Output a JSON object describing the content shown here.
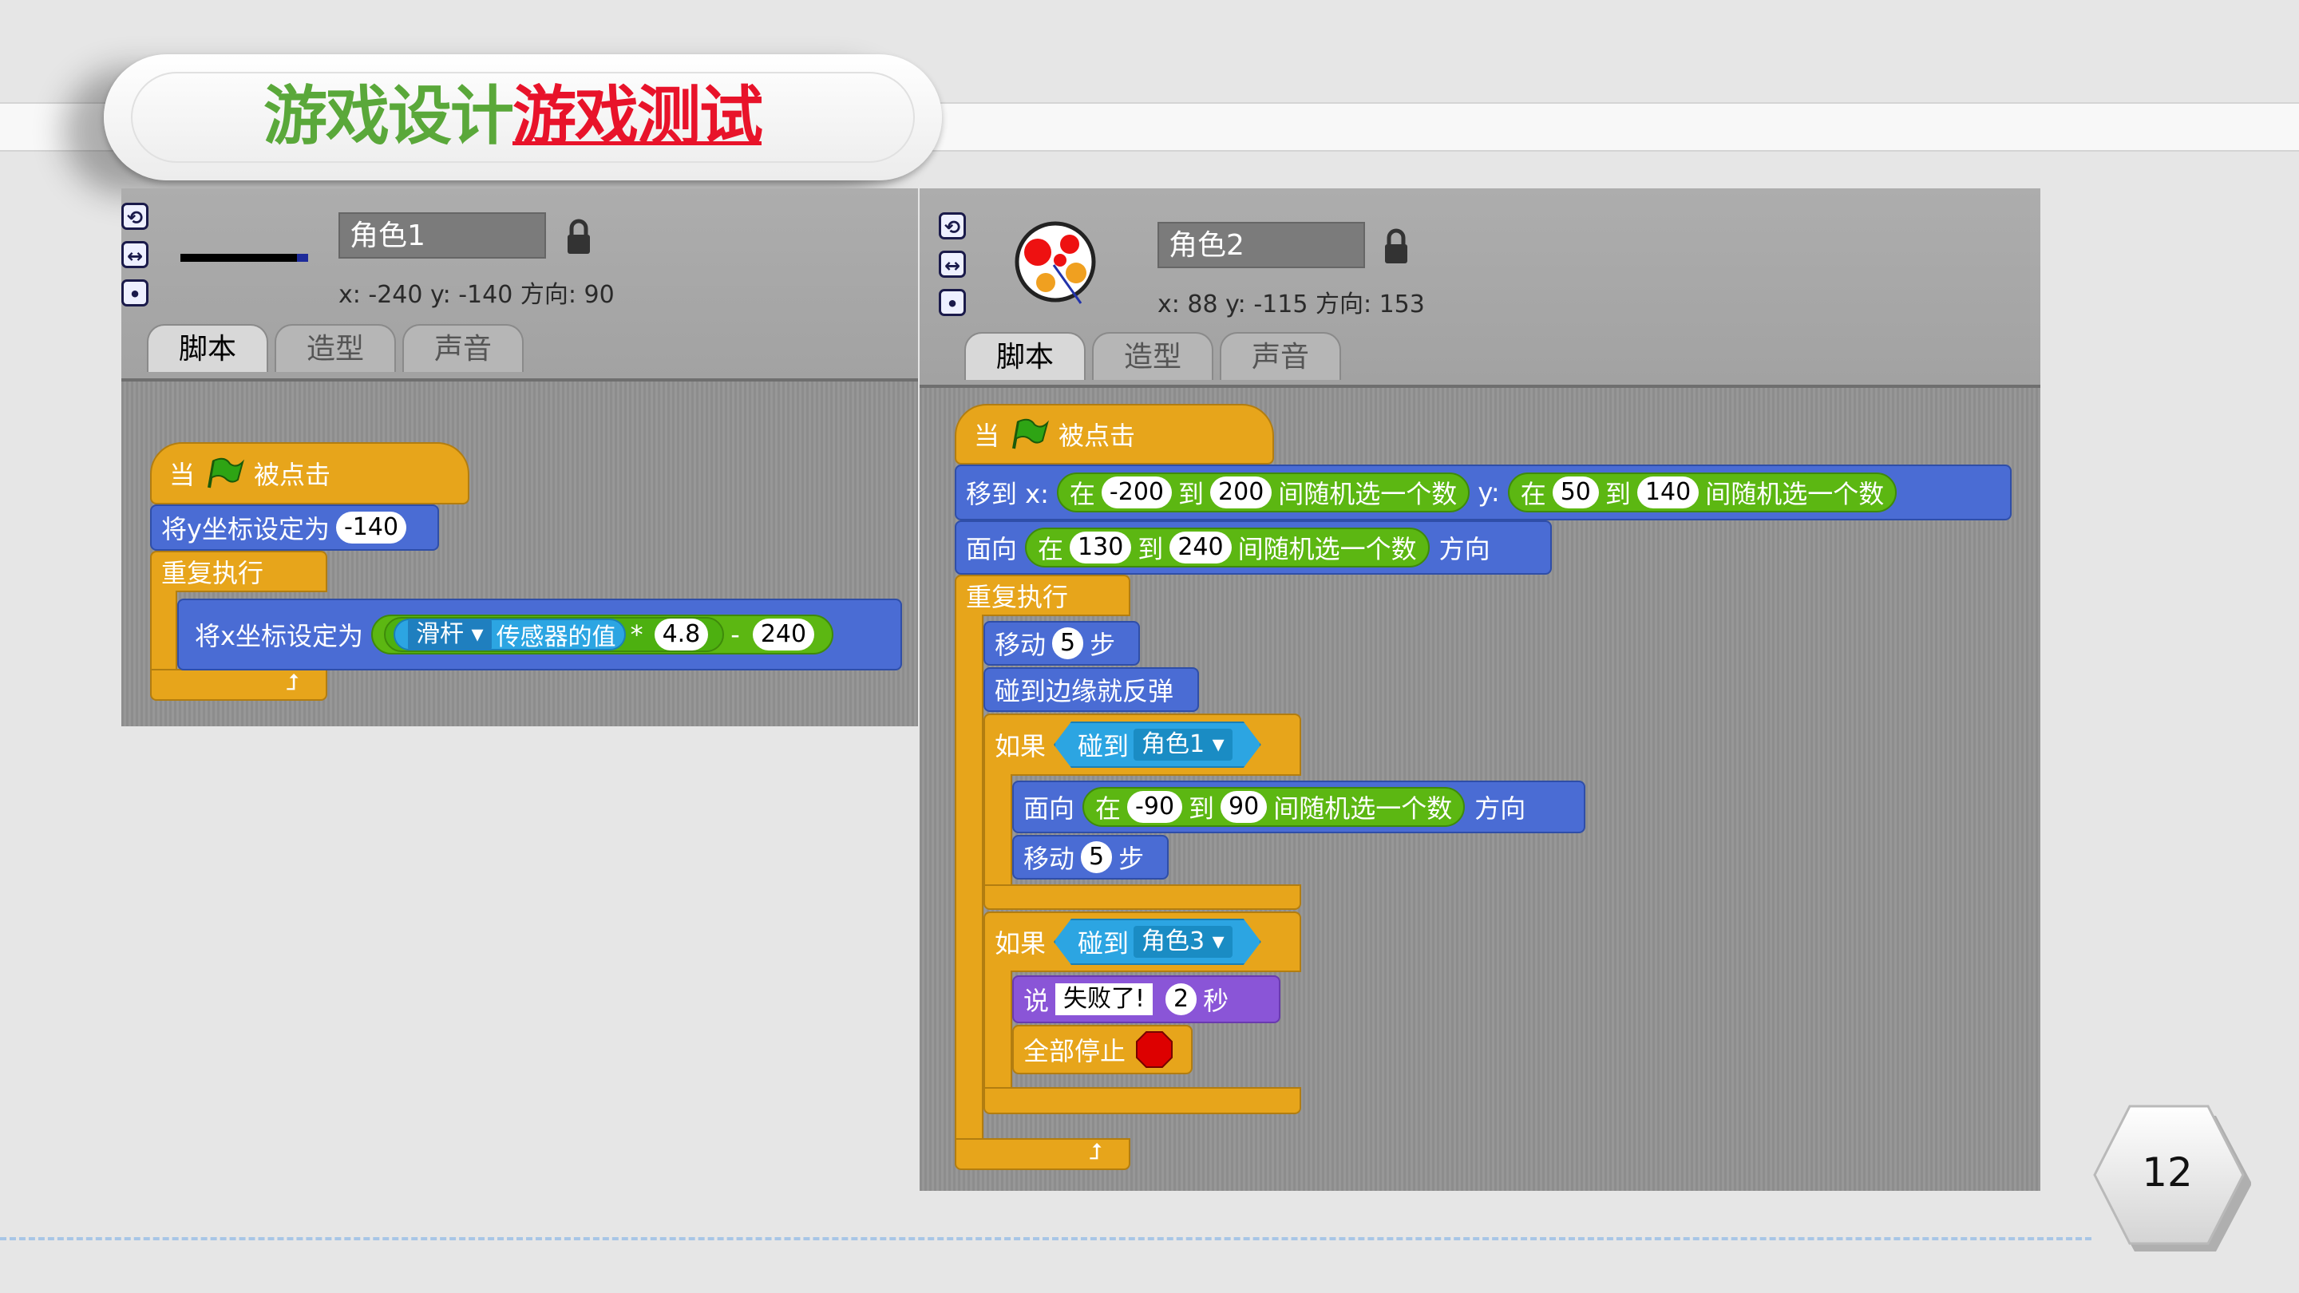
{
  "title": {
    "part1": "游戏设计",
    "part2": "游戏测试"
  },
  "page_number": "12",
  "left_panel": {
    "sprite_name": "角色1",
    "coords": "x: -240 y: -140 方向: 90",
    "tabs": [
      "脚本",
      "造型",
      "声音"
    ],
    "script": {
      "hat": "当",
      "hat_suffix": "被点击",
      "set_y": "将y坐标设定为",
      "set_y_value": "-140",
      "forever": "重复执行",
      "set_x": "将x坐标设定为",
      "slider": "滑杆",
      "sensor": "传感器的值",
      "times": "*",
      "factor": "4.8",
      "minus": "-",
      "offset": "240"
    }
  },
  "right_panel": {
    "sprite_name": "角色2",
    "coords": "x: 88   y: -115 方向: 153",
    "tabs": [
      "脚本",
      "造型",
      "声音"
    ],
    "script": {
      "hat": "当",
      "hat_suffix": "被点击",
      "goto": "移到 x:",
      "in": "在",
      "to": "到",
      "pick": "间随机选一个数",
      "y_label": "y:",
      "x_from": "-200",
      "x_to": "200",
      "y_from": "50",
      "y_to": "140",
      "face": "面向",
      "dir_from": "130",
      "dir_to": "240",
      "direction": "方向",
      "forever": "重复执行",
      "move": "移动",
      "steps": "步",
      "move_value": "5",
      "bounce": "碰到边缘就反弹",
      "if": "如果",
      "touching": "碰到",
      "target1": "角色1",
      "face_from": "-90",
      "face_to": "90",
      "target3": "角色3",
      "say": "说",
      "say_text": "失败了!",
      "secs_value": "2",
      "secs": "秒",
      "stop_all": "全部停止"
    }
  },
  "colors": {
    "control": "#e7a51b",
    "motion": "#4a6cd4",
    "operators": "#5cb712",
    "sensing": "#2ca5e2",
    "looks": "#8a55d7"
  }
}
